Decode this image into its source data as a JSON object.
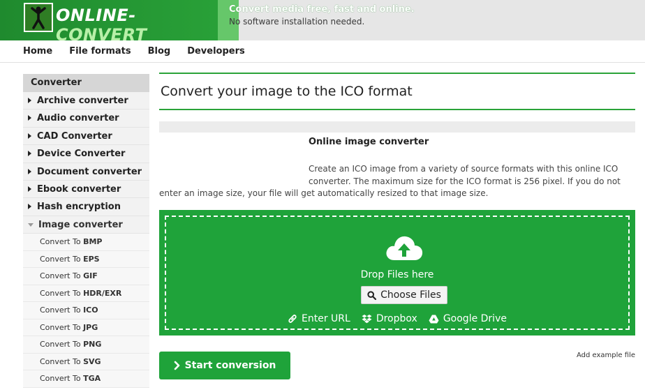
{
  "header": {
    "logo_text_a": "ONLINE-",
    "logo_text_b": "CONVERT",
    "tagline_main": "Convert media free, fast and online.",
    "tagline_sub": "No software installation needed."
  },
  "nav": {
    "items": [
      "Home",
      "File formats",
      "Blog",
      "Developers"
    ]
  },
  "sidebar": {
    "heading": "Converter",
    "items": [
      "Archive converter",
      "Audio converter",
      "CAD Converter",
      "Device Converter",
      "Document converter",
      "Ebook converter",
      "Hash encryption",
      "Image converter"
    ],
    "sub_prefix": "Convert To",
    "sub_items": [
      "BMP",
      "EPS",
      "GIF",
      "HDR/EXR",
      "ICO",
      "JPG",
      "PNG",
      "SVG",
      "TGA"
    ]
  },
  "main": {
    "title": "Convert your image to the ICO format",
    "info_title": "Online image converter",
    "info_line1": "Create an ICO image from a variety of source formats with this online ICO",
    "info_line2": "converter. The maximum size for the ICO format is 256 pixel. If you do not",
    "info_line3": "enter an image size, your file will get automatically resized to that image size."
  },
  "dropzone": {
    "drop_text": "Drop Files here",
    "choose_label": "Choose Files",
    "url_label": "Enter URL",
    "dropbox_label": "Dropbox",
    "gdrive_label": "Google Drive"
  },
  "actions": {
    "start_label": "Start conversion",
    "example_label": "Add example file"
  },
  "colors": {
    "brand_green": "#1fa33a",
    "sidebar_bg": "#f2f2f2"
  }
}
